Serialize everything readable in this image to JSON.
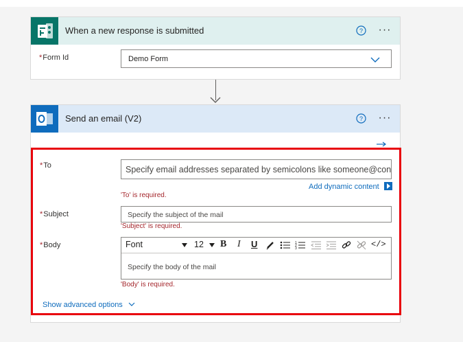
{
  "trigger": {
    "title": "When a new response is submitted",
    "field_label": "Form Id",
    "field_value": "Demo Form",
    "header_color": "#dff0ef",
    "icon_color": "#077568",
    "icon": "forms-icon"
  },
  "action": {
    "title": "Send an email (V2)",
    "header_color": "#dce9f7",
    "icon_color": "#0f6cbd",
    "icon": "outlook-icon",
    "to_label": "To",
    "to_placeholder": "Specify email addresses separated by semicolons like someone@con",
    "add_dynamic_label": "Add dynamic content",
    "to_error": "'To' is required.",
    "subject_label": "Subject",
    "subject_placeholder": "Specify the subject of the mail",
    "subject_error": "'Subject' is required.",
    "body_label": "Body",
    "body_placeholder": "Specify the body of the mail",
    "body_error": "'Body' is required.",
    "font_name": "Font",
    "font_size": "12",
    "advanced_label": "Show advanced options",
    "required_mark": "*"
  },
  "colors": {
    "highlight": "#e8000b",
    "link": "#0f6cbd",
    "error": "#a4262c"
  }
}
